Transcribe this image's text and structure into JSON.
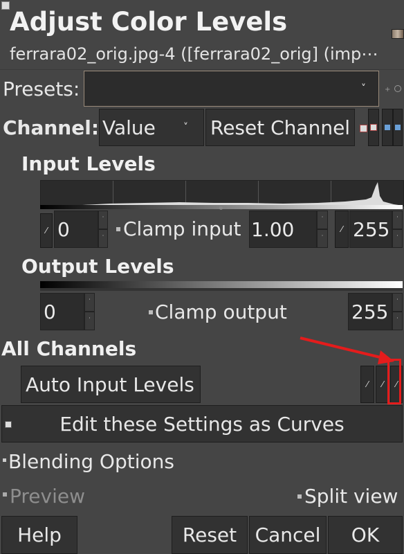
{
  "window": {
    "title": "Adjust Color Levels",
    "subtitle": "ferrara02_orig.jpg-4 ([ferrara02_orig] (imp⋯"
  },
  "presets": {
    "label": "Presets:",
    "value": ""
  },
  "channel": {
    "label": "Channel:",
    "value": "Value",
    "reset_label": "Reset Channel"
  },
  "input_levels": {
    "title": "Input Levels",
    "low": "0",
    "gamma": "1.00",
    "high": "255",
    "clamp_label": "Clamp input"
  },
  "output_levels": {
    "title": "Output Levels",
    "low": "0",
    "high": "255",
    "clamp_label": "Clamp output"
  },
  "all_channels": {
    "title": "All Channels",
    "auto_label": "Auto Input Levels",
    "edit_curves_label": "Edit these Settings as Curves"
  },
  "blending": {
    "label": "Blending Options"
  },
  "preview": {
    "label": "Preview",
    "split_label": "Split view"
  },
  "buttons": {
    "help": "Help",
    "reset": "Reset",
    "cancel": "Cancel",
    "ok": "OK"
  },
  "annotation": {
    "color": "#e41c1c"
  },
  "colors": {
    "background": "#454545",
    "field": "#2c2c2c",
    "button": "#323232"
  }
}
